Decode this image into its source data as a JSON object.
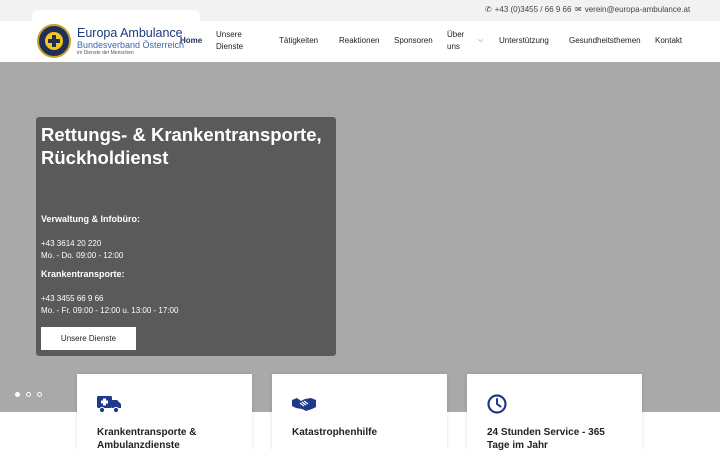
{
  "topbar": {
    "phone": "+43 (0)3455 / 66 9 66",
    "email": "verein@europa-ambulance.at"
  },
  "logo": {
    "title": "Europa Ambulance",
    "subtitle": "Bundesverband Österreich",
    "tagline": "im Dienste der Menschen"
  },
  "nav": {
    "items": [
      {
        "label": "Home"
      },
      {
        "label": "Unsere Dienste"
      },
      {
        "label": "Tätigkeiten"
      },
      {
        "label": "Reaktionen"
      },
      {
        "label": "Sponsoren"
      },
      {
        "label": "Über uns"
      },
      {
        "label": "Unterstützung"
      },
      {
        "label": "Gesundheitsthemen"
      },
      {
        "label": "Kontakt"
      }
    ]
  },
  "hero": {
    "title": "Rettungs- & Krankentransporte, Rückholdienst",
    "admin_heading": "Verwaltung & Infobüro:",
    "admin_phone": "+43 3614 20 220",
    "admin_hours": "Mo. - Do. 09:00 - 12:00",
    "transport_heading": "Krankentransporte:",
    "transport_phone": "+43 3455 66 9 66",
    "transport_hours": "Mo. - Fr. 09:00 - 12:00 u. 13:00 - 17:00",
    "button_label": "Unsere Dienste"
  },
  "slider": {
    "dots": 3,
    "active": 1
  },
  "cards": [
    {
      "title": "Krankentransporte & Ambulanzdienste",
      "icon": "ambulance-icon"
    },
    {
      "title": "Katastrophenhilfe",
      "icon": "handshake-icon"
    },
    {
      "title": "24 Stunden Service - 365 Tage im Jahr",
      "icon": "clock-icon"
    }
  ],
  "colors": {
    "brand_navy": "#1f2f5c",
    "brand_yellow": "#f3c81a",
    "hero_overlay": "#5a5a5a",
    "icon_blue": "#1f3a8a"
  }
}
